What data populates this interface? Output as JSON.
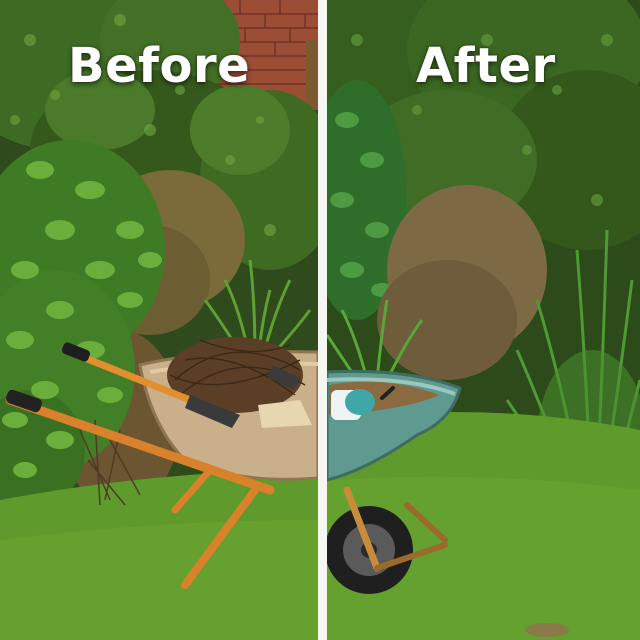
{
  "captions": {
    "before": "Before",
    "after": "After"
  },
  "colors": {
    "divider": "#f6f6f2",
    "lawn": "#5f9a2c",
    "brick": "#a9553e",
    "wheelbarrow_before_tray": "#c9b08a",
    "wheelbarrow_after_tray": "#5e9a8f",
    "handle_orange": "#d9822b"
  }
}
